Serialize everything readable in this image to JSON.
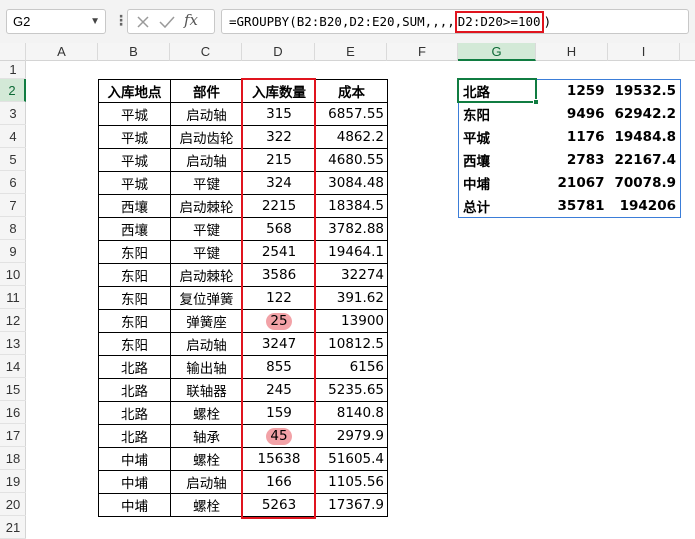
{
  "name_box": {
    "value": "G2"
  },
  "formula": {
    "prefix": "=GROUPBY(B2:B20,D2:E20,SUM,,,,",
    "highlight": "D2:D20>=100",
    "suffix": ")"
  },
  "columns": [
    "A",
    "B",
    "C",
    "D",
    "E",
    "F",
    "G",
    "H",
    "I"
  ],
  "selected_column": "G",
  "rows": [
    "1",
    "2",
    "3",
    "4",
    "5",
    "6",
    "7",
    "8",
    "9",
    "10",
    "11",
    "12",
    "13",
    "14",
    "15",
    "16",
    "17",
    "18",
    "19",
    "20",
    "21"
  ],
  "selected_row": "2",
  "main_table": {
    "headers": [
      "入库地点",
      "部件",
      "入库数量",
      "成本"
    ],
    "rows": [
      [
        "平城",
        "启动轴",
        "315",
        "6857.55"
      ],
      [
        "平城",
        "启动齿轮",
        "322",
        "4862.2"
      ],
      [
        "平城",
        "启动轴",
        "215",
        "4680.55"
      ],
      [
        "平城",
        "平键",
        "324",
        "3084.48"
      ],
      [
        "西壤",
        "启动棘轮",
        "2215",
        "18384.5"
      ],
      [
        "西壤",
        "平键",
        "568",
        "3782.88"
      ],
      [
        "东阳",
        "平键",
        "2541",
        "19464.1"
      ],
      [
        "东阳",
        "启动棘轮",
        "3586",
        "32274"
      ],
      [
        "东阳",
        "复位弹簧",
        "122",
        "391.62"
      ],
      [
        "东阳",
        "弹簧座",
        "25",
        "13900"
      ],
      [
        "东阳",
        "启动轴",
        "3247",
        "10812.5"
      ],
      [
        "北路",
        "输出轴",
        "855",
        "6156"
      ],
      [
        "北路",
        "联轴器",
        "245",
        "5235.65"
      ],
      [
        "北路",
        "螺栓",
        "159",
        "8140.8"
      ],
      [
        "北路",
        "轴承",
        "45",
        "2979.9"
      ],
      [
        "中埔",
        "螺栓",
        "15638",
        "51605.4"
      ],
      [
        "中埔",
        "启动轴",
        "166",
        "1105.56"
      ],
      [
        "中埔",
        "螺栓",
        "5263",
        "17367.9"
      ]
    ],
    "highlighted_quantity_rows": [
      9,
      14
    ],
    "highlight_color": "#f2a2a7"
  },
  "result_table": {
    "rows": [
      [
        "北路",
        "1259",
        "19532.5"
      ],
      [
        "东阳",
        "9496",
        "62942.2"
      ],
      [
        "平城",
        "1176",
        "19484.8"
      ],
      [
        "西壤",
        "2783",
        "22167.4"
      ],
      [
        "中埔",
        "21067",
        "70078.9"
      ],
      [
        "总计",
        "35781",
        "194206"
      ]
    ]
  },
  "colors": {
    "accent_red": "#e0141e",
    "selection_green": "#107c41",
    "spill_border_blue": "#3b7dd8"
  }
}
